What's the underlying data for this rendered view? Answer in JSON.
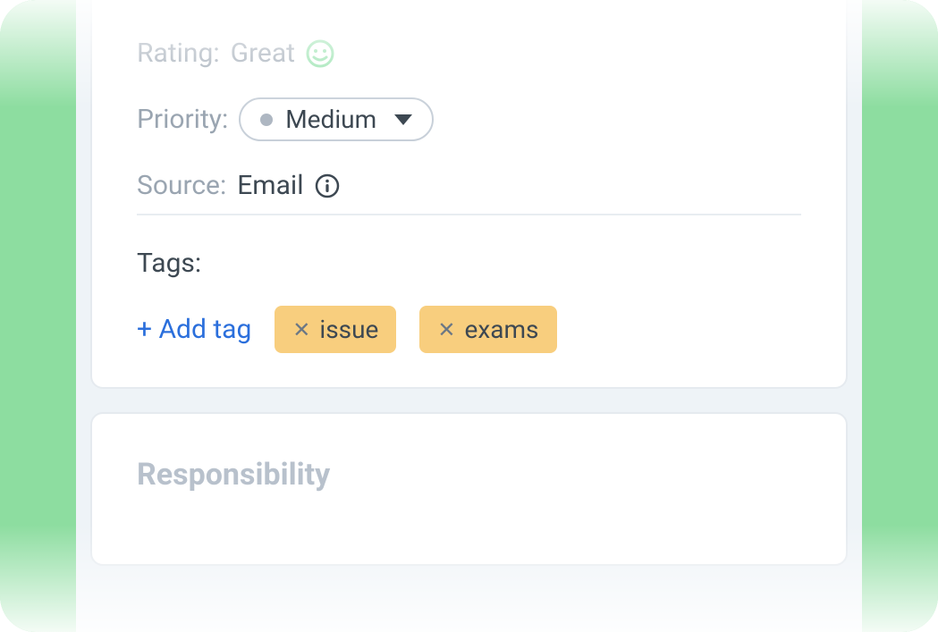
{
  "details": {
    "rating": {
      "label": "Rating:",
      "value": "Great"
    },
    "priority": {
      "label": "Priority:",
      "value": "Medium"
    },
    "source": {
      "label": "Source:",
      "value": "Email"
    },
    "tags": {
      "label": "Tags:",
      "add_label": "+ Add tag",
      "items": [
        "issue",
        "exams"
      ]
    }
  },
  "responsibility": {
    "heading": "Responsibility"
  },
  "colors": {
    "frame_green": "#8ddda0",
    "tag_bg": "#f8ce7e",
    "link_blue": "#2b6fdc",
    "smiley_green": "#6fd18e"
  }
}
